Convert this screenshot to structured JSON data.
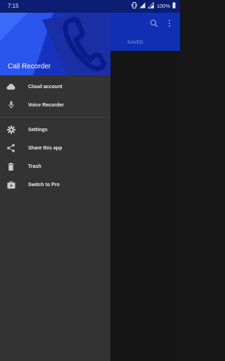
{
  "status_bar": {
    "time": "7:15",
    "battery": "100%",
    "icons": [
      "vibrate-icon",
      "signal-icon",
      "wifi-icon",
      "battery-icon"
    ]
  },
  "app_bar": {
    "tab_label": "SAVED",
    "actions": [
      "search-icon",
      "overflow-menu-icon"
    ]
  },
  "drawer": {
    "title": "Call Recorder",
    "header_icon": "phone-icon",
    "group1": [
      {
        "label": "Cloud account",
        "icon": "cloud-icon"
      },
      {
        "label": "Voice Recorder",
        "icon": "microphone-icon"
      }
    ],
    "group2": [
      {
        "label": "Settings",
        "icon": "gear-icon"
      },
      {
        "label": "Share this app",
        "icon": "share-icon"
      },
      {
        "label": "Trash",
        "icon": "trash-icon"
      },
      {
        "label": "Switch to Pro",
        "icon": "briefcase-icon"
      }
    ]
  },
  "colors": {
    "status_bar": "#0b1e73",
    "app_bar": "#0f2fb4",
    "drawer_header": "#1f3bd4",
    "drawer_bg": "#333333",
    "scrim": "#161616"
  }
}
